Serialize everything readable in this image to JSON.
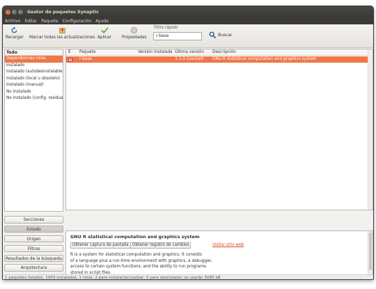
{
  "window": {
    "title": "Gestor de paquetes Synaptic"
  },
  "menu": [
    "Archivo",
    "Editar",
    "Paquete",
    "Configuración",
    "Ayuda"
  ],
  "toolbar": {
    "reload_label": "Recargar",
    "mark_all_label": "Marcar todas las actualizaciones",
    "apply_label": "Aplicar",
    "properties_label": "Propiedades",
    "filter_label": "Filtro rápido",
    "filter_value": "r-base",
    "search_label": "Buscar"
  },
  "filters": {
    "header": "Todo",
    "items": [
      "Dependencias rotas",
      "Instalado",
      "Instalado (autodesinstalable)",
      "Instalado (local u obsoleto)",
      "Instalado (manual)",
      "No instalado",
      "No instalado (config. residual)"
    ],
    "selected_index": 0
  },
  "side_buttons": [
    "Secciones",
    "Estado",
    "Origen",
    "Filtros",
    "Resultados de la búsqueda",
    "Arquitectura"
  ],
  "active_side_button": 1,
  "table": {
    "columns": [
      "E",
      "Paquete",
      "Versión instalada",
      "Última versión",
      "Descripción"
    ],
    "rows": [
      {
        "status": "broken",
        "package": "r-base",
        "installed": "",
        "latest": "3.3.3-1xenial0",
        "description": "GNU R statistical computation and graphics system"
      }
    ]
  },
  "details": {
    "title": "GNU R statistical computation and graphics system",
    "screenshot_button": "Obtener captura de pantalla",
    "changelog_button": "Obtener registro de cambios",
    "website_link": "Visitar sitio web",
    "description_lines": [
      "R is a system for statistical computation and graphics.  It consists",
      "of a language plus a run-time environment with graphics, a debugger,",
      "access to certain system functions, and the ability to run programs",
      "stored in script files."
    ]
  },
  "status_bar": "1 paquetes listados, 1959 instalados, 1 rotos. 2 para instalar/actualizar, 0 para desinstalar; se usarán 3085 kB",
  "colors": {
    "accent": "#f07746",
    "titlebar": "#3c3b37",
    "link": "#dd4814"
  }
}
